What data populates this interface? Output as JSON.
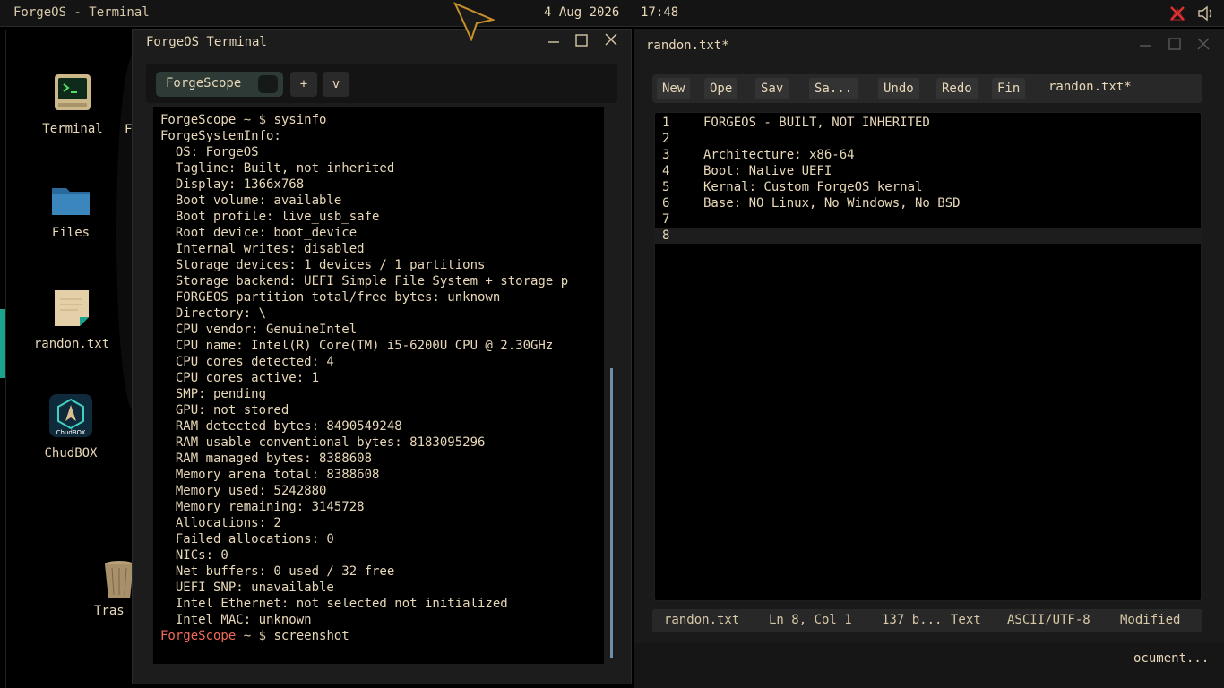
{
  "topbar": {
    "title": "ForgeOS - Terminal",
    "date": "4 Aug 2026",
    "time": "17:48",
    "network_icon": "network-disconnected-icon",
    "volume_icon": "volume-icon",
    "network_color": "#e03030"
  },
  "desktop": {
    "icons": [
      {
        "label": "Terminal",
        "icon": "terminal-icon"
      },
      {
        "label": "Files",
        "icon": "folder-icon"
      },
      {
        "label": "randon.txt",
        "icon": "text-file-icon"
      },
      {
        "label": "ChudBOX",
        "icon": "chudbox-app-icon",
        "badge": "ChudBOX"
      },
      {
        "label": "Tras",
        "icon": "trash-icon"
      }
    ],
    "partial_label": "F",
    "accent": "#1ba38e"
  },
  "terminal": {
    "window_title": "ForgeOS Terminal",
    "tab_label": "ForgeScope",
    "new_tab_label": "+",
    "menu_label": "v",
    "prompt_user": "ForgeScope",
    "prompt_sep": " ~ $ ",
    "prompt_color": "#f06a5a",
    "command1": "sysinfo",
    "output": [
      "ForgeSystemInfo:",
      "  OS: ForgeOS",
      "  Tagline: Built, not inherited",
      "  Display: 1366x768",
      "  Boot volume: available",
      "  Boot profile: live_usb_safe",
      "  Root device: boot_device",
      "  Internal writes: disabled",
      "  Storage devices: 1 devices / 1 partitions",
      "  Storage backend: UEFI Simple File System + storage p",
      "  FORGEOS partition total/free bytes: unknown",
      "  Directory: \\",
      "  CPU vendor: GenuineIntel",
      "  CPU name: Intel(R) Core(TM) i5-6200U CPU @ 2.30GHz",
      "  CPU cores detected: 4",
      "  CPU cores active: 1",
      "  SMP: pending",
      "  GPU: not stored",
      "  RAM detected bytes: 8490549248",
      "  RAM usable conventional bytes: 8183095296",
      "  RAM managed bytes: 8388608",
      "  Memory arena total: 8388608",
      "  Memory used: 5242880",
      "  Memory remaining: 3145728",
      "  Allocations: 2",
      "  Failed allocations: 0",
      "  NICs: 0",
      "  Net buffers: 0 used / 32 free",
      "  UEFI SNP: unavailable",
      "  Intel Ethernet: not selected not initialized",
      "  Intel MAC: unknown"
    ],
    "command2": "screenshot"
  },
  "editor": {
    "window_title": "randon.txt*",
    "toolbar": {
      "new": "New",
      "open": "Ope",
      "save": "Sav",
      "save_as": "Sa...",
      "undo": "Undo",
      "redo": "Redo",
      "find": "Fin",
      "filename": "randon.txt*"
    },
    "lines": [
      {
        "num": "1",
        "text": "FORGEOS - BUILT, NOT INHERITED"
      },
      {
        "num": "2",
        "text": ""
      },
      {
        "num": "3",
        "text": "Architecture: x86-64"
      },
      {
        "num": "4",
        "text": "Boot: Native UEFI"
      },
      {
        "num": "5",
        "text": "Kernal: Custom ForgeOS kernal"
      },
      {
        "num": "6",
        "text": "Base: NO Linux, No Windows, No BSD"
      },
      {
        "num": "7",
        "text": ""
      },
      {
        "num": "8",
        "text": ""
      }
    ],
    "current_line": 8,
    "status": {
      "file": "randon.txt",
      "position": "Ln 8, Col 1",
      "size": "137 b...",
      "type": "Text",
      "encoding": "ASCII/UTF-8",
      "state": "Modified"
    }
  },
  "taskbar_hint": "ocument..."
}
